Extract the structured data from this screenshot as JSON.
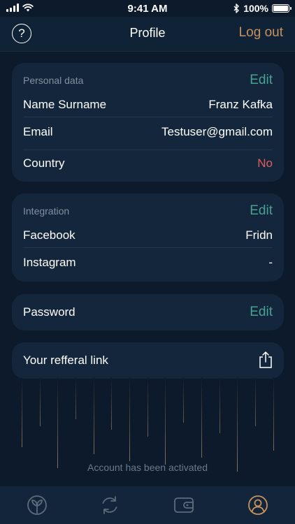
{
  "status_bar": {
    "time": "9:41 AM",
    "battery": "100%",
    "icons": [
      "signal-icon",
      "wifi-icon",
      "bluetooth-icon",
      "battery-icon"
    ]
  },
  "nav": {
    "help_label": "?",
    "title": "Profile",
    "logout_label": "Log out"
  },
  "personal": {
    "label": "Personal data",
    "edit_label": "Edit",
    "rows": [
      {
        "label": "Name Surname",
        "value": "Franz Kafka"
      },
      {
        "label": "Email",
        "value": "Testuser@gmail.com"
      },
      {
        "label": "Country",
        "value": "No"
      }
    ]
  },
  "integration": {
    "label": "Integration",
    "edit_label": "Edit",
    "rows": [
      {
        "label": "Facebook",
        "value": "Fridn"
      },
      {
        "label": "Instagram",
        "value": "-"
      }
    ]
  },
  "password": {
    "label": "Password",
    "edit_label": "Edit"
  },
  "referral": {
    "label": "Your refferal link",
    "icon": "share-icon"
  },
  "activation": {
    "text": "Account has been activated"
  },
  "tabs": [
    {
      "name": "home",
      "icon": "sprout-icon",
      "active": false
    },
    {
      "name": "exchange",
      "icon": "refresh-icon",
      "active": false
    },
    {
      "name": "wallet",
      "icon": "wallet-icon",
      "active": false
    },
    {
      "name": "profile",
      "icon": "user-icon",
      "active": true
    }
  ],
  "colors": {
    "accent_edit": "#4aa092",
    "logout": "#c7925f",
    "negative": "#e05a5a",
    "active_tab": "#c7925f",
    "inactive_tab": "#5d6c7c"
  }
}
